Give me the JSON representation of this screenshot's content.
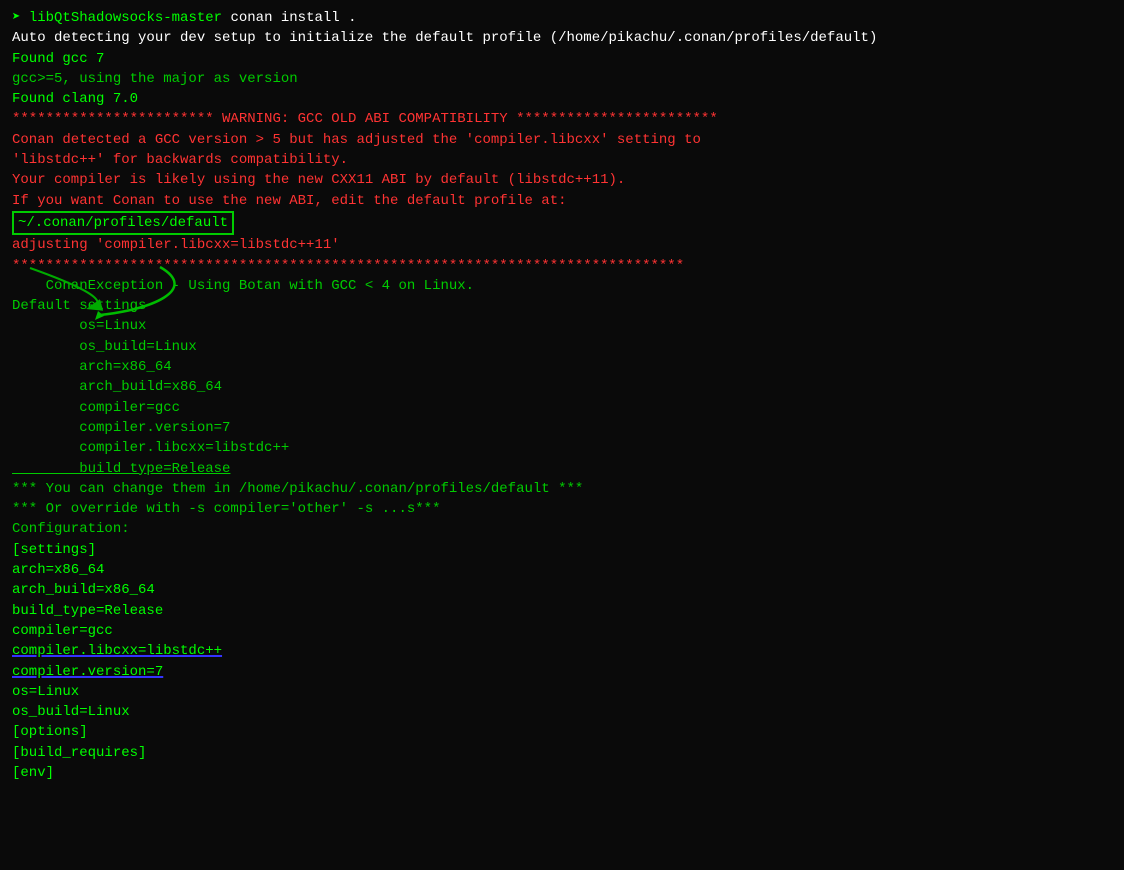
{
  "terminal": {
    "lines": [
      {
        "id": "l1",
        "type": "mixed",
        "segments": [
          {
            "text": "➤ libQtShadowsocks-master",
            "color": "bright-green"
          },
          {
            "text": " conan install .",
            "color": "white"
          }
        ]
      },
      {
        "id": "l2",
        "text": "Auto detecting your dev setup to initialize the default profile (/home/pikachu/.conan/profiles/default)",
        "color": "white"
      },
      {
        "id": "l3",
        "type": "mixed",
        "segments": [
          {
            "text": "Found gcc 7",
            "color": "bright-green"
          }
        ]
      },
      {
        "id": "l4",
        "text": "gcc>=5, using the major as version",
        "color": "default"
      },
      {
        "id": "l5",
        "type": "mixed",
        "segments": [
          {
            "text": "Found clang 7.0",
            "color": "bright-green"
          }
        ]
      },
      {
        "id": "l6",
        "text": "",
        "color": "default"
      },
      {
        "id": "l7",
        "text": "************************ WARNING: GCC OLD ABI COMPATIBILITY ************************",
        "color": "red"
      },
      {
        "id": "l8",
        "text": "",
        "color": "default"
      },
      {
        "id": "l9",
        "text": "Conan detected a GCC version > 5 but has adjusted the 'compiler.libcxx' setting to",
        "color": "red"
      },
      {
        "id": "l10",
        "text": "'libstdc++' for backwards compatibility.",
        "color": "red"
      },
      {
        "id": "l11",
        "text": "Your compiler is likely using the new CXX11 ABI by default (libstdc++11).",
        "color": "red"
      },
      {
        "id": "l12",
        "text": "",
        "color": "default"
      },
      {
        "id": "l13",
        "text": "If you want Conan to use the new ABI, edit the default profile at:",
        "color": "red"
      },
      {
        "id": "l14",
        "type": "boxed",
        "text": "~/.conan/profiles/default",
        "color": "bright-green"
      },
      {
        "id": "l15",
        "text": "",
        "color": "default"
      },
      {
        "id": "l16",
        "text": "adjusting 'compiler.libcxx=libstdc++11'",
        "color": "red"
      },
      {
        "id": "l17",
        "text": "",
        "color": "default"
      },
      {
        "id": "l18",
        "text": "********************************************************************************",
        "color": "red"
      },
      {
        "id": "l19",
        "text": "    ConanException - Using Botan with GCC < 4 on Linux.",
        "color": "default"
      },
      {
        "id": "l20",
        "text": "",
        "color": "default"
      },
      {
        "id": "l21",
        "text": "Default settings",
        "color": "default"
      },
      {
        "id": "l22",
        "text": "        os=Linux",
        "color": "default"
      },
      {
        "id": "l23",
        "text": "        os_build=Linux",
        "color": "default"
      },
      {
        "id": "l24",
        "text": "        arch=x86_64",
        "color": "default"
      },
      {
        "id": "l25",
        "text": "        arch_build=x86_64",
        "color": "default"
      },
      {
        "id": "l26",
        "text": "        compiler=gcc",
        "color": "default"
      },
      {
        "id": "l27",
        "text": "        compiler.version=7",
        "color": "default"
      },
      {
        "id": "l28",
        "text": "        compiler.libcxx=libstdc++",
        "color": "default"
      },
      {
        "id": "l29",
        "type": "underline-green",
        "text": "        build_type=Release",
        "color": "default"
      },
      {
        "id": "l30",
        "type": "mixed",
        "segments": [
          {
            "text": "*** You can change them in /home/pikachu/.conan/profiles/default ***",
            "color": "default"
          }
        ]
      },
      {
        "id": "l31",
        "text": "*** Or override with -s compiler='other' -s ...s***",
        "color": "default"
      },
      {
        "id": "l32",
        "text": "",
        "color": "default"
      },
      {
        "id": "l33",
        "text": "Configuration:",
        "color": "default"
      },
      {
        "id": "l34",
        "text": "[settings]",
        "color": "bright-green"
      },
      {
        "id": "l35",
        "text": "arch=x86_64",
        "color": "bright-green"
      },
      {
        "id": "l36",
        "text": "arch_build=x86_64",
        "color": "bright-green"
      },
      {
        "id": "l37",
        "text": "build_type=Release",
        "color": "bright-green"
      },
      {
        "id": "l38",
        "text": "compiler=gcc",
        "color": "bright-green"
      },
      {
        "id": "l39",
        "type": "underline-blue",
        "text": "compiler.libcxx=libstdc++",
        "color": "bright-green"
      },
      {
        "id": "l40",
        "type": "underline-blue",
        "text": "compiler.version=7",
        "color": "bright-green"
      },
      {
        "id": "l41",
        "text": "os=Linux",
        "color": "bright-green"
      },
      {
        "id": "l42",
        "text": "os_build=Linux",
        "color": "bright-green"
      },
      {
        "id": "l43",
        "text": "[options]",
        "color": "bright-green"
      },
      {
        "id": "l44",
        "text": "[build_requires]",
        "color": "bright-green"
      },
      {
        "id": "l45",
        "text": "[env]",
        "color": "bright-green"
      }
    ]
  }
}
